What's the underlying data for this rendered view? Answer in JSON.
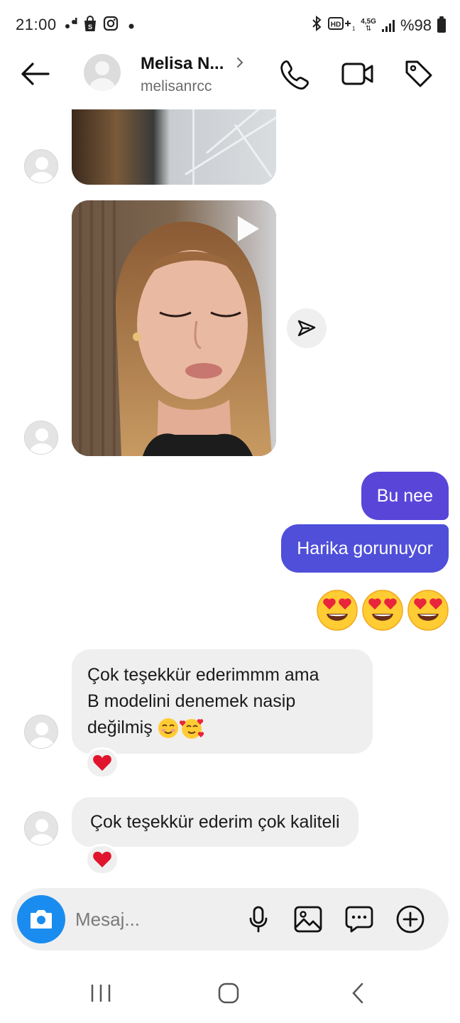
{
  "status_bar": {
    "time": "21:00",
    "battery": "%98",
    "network": "4,5G",
    "left_icons": [
      "voicemail-icon",
      "shopping-bag-icon",
      "instagram-icon",
      "dot-icon"
    ],
    "right_icons": [
      "bluetooth-icon",
      "hd-volte-icon",
      "data-arrows-icon",
      "signal-icon",
      "battery-icon"
    ]
  },
  "header": {
    "contact_name": "Melisa N...",
    "username": "melisanrcc",
    "icons": [
      "back-arrow-icon",
      "chevron-right-icon",
      "phone-icon",
      "video-camera-icon",
      "tag-icon"
    ]
  },
  "messages": {
    "outgoing_1": "Bu nee",
    "outgoing_2": "Harika gorunuyor",
    "emoji_count": 3,
    "incoming_1": {
      "line1": "Çok teşekkür ederimmm ama",
      "line2": "B modelini denemek nasip",
      "line3": "değilmiş"
    },
    "incoming_2": "Çok teşekkür ederim çok kaliteli",
    "reactions": [
      "heart-icon",
      "heart-icon"
    ]
  },
  "composer": {
    "placeholder": "Mesaj..."
  },
  "colors": {
    "outgoing_bubble": "#5a45d9",
    "incoming_bubble": "#efefef",
    "camera_button": "#1a8cf0",
    "heart": "#e0152d"
  }
}
